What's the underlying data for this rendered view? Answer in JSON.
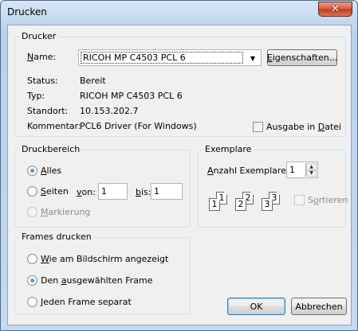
{
  "window": {
    "title": "Drucken",
    "close_glyph": "✕"
  },
  "printer": {
    "group_title": "Drucker",
    "name_label_prefix": "N",
    "name_label_rest": "ame:",
    "name_value": "RICOH MP C4503 PCL 6",
    "properties_button_ul": "E",
    "properties_button_rest": "igenschaften...",
    "status_label": "Status:",
    "status_value": "Bereit",
    "type_label": "Typ:",
    "type_value": "RICOH MP C4503 PCL 6",
    "location_label": "Standort:",
    "location_value": "10.153.202.7",
    "comment_label": "Kommentar:",
    "comment_value": "PCL6 Driver (For Windows)",
    "print_to_file_pre": "Ausgabe in ",
    "print_to_file_ul": "D",
    "print_to_file_post": "atei",
    "print_to_file_checked": false
  },
  "range": {
    "group_title": "Druckbereich",
    "all_ul": "A",
    "all_rest": "lles",
    "all_selected": true,
    "pages_ul": "S",
    "pages_rest": "eiten",
    "pages_selected": false,
    "from_ul": "v",
    "from_rest": "on:",
    "from_value": "1",
    "to_ul": "b",
    "to_rest": "is:",
    "to_value": "1",
    "selection_ul": "M",
    "selection_rest": "arkierung",
    "selection_enabled": false
  },
  "copies": {
    "group_title": "Exemplare",
    "count_label_ul": "A",
    "count_label_rest": "nzahl Exemplare:",
    "count_value": "1",
    "collate_ul": "o",
    "collate_pre": "S",
    "collate_rest": "rtieren",
    "collate_checked": false,
    "collate_pages": [
      "1",
      "1",
      "2",
      "2",
      "3",
      "3"
    ]
  },
  "frames": {
    "group_title": "Frames drucken",
    "option1_ul": "W",
    "option1_rest": "ie am Bildschirm angezeigt",
    "option2_pre": "Den ",
    "option2_ul": "a",
    "option2_rest": "usgewählten Frame",
    "option3_ul": "J",
    "option3_rest": "eden Frame separat",
    "selected": "option2"
  },
  "buttons": {
    "ok": "OK",
    "cancel": "Abbrechen"
  }
}
